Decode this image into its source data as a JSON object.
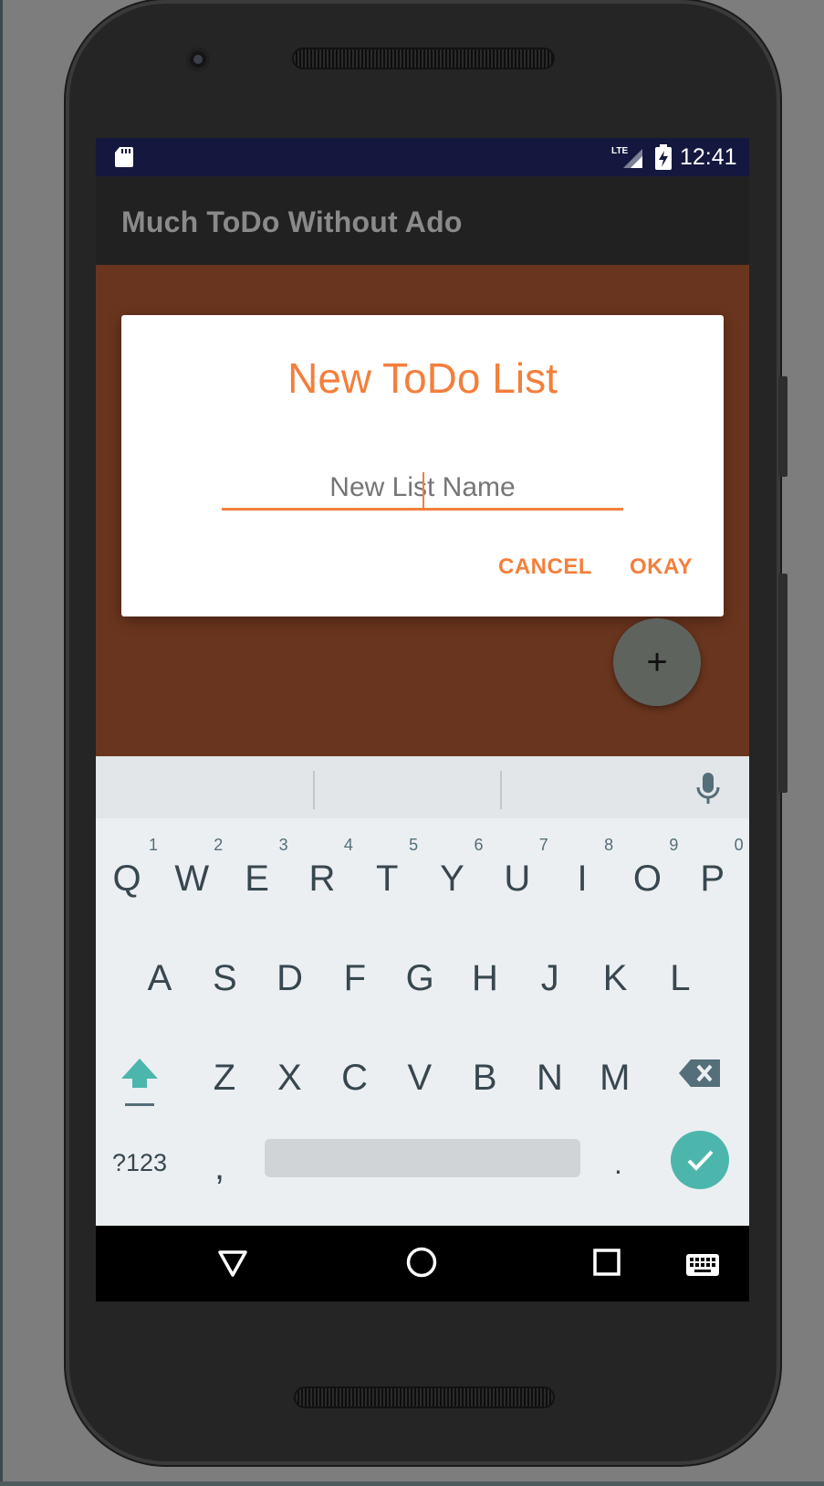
{
  "status_bar": {
    "time": "12:41",
    "icons": [
      "sd-card-icon",
      "lte-signal-icon",
      "battery-charging-icon"
    ]
  },
  "app_bar": {
    "title": "Much ToDo Without Ado"
  },
  "dialog": {
    "title": "New ToDo List",
    "input_placeholder": "New List Name",
    "input_value": "",
    "cancel_label": "CANCEL",
    "okay_label": "OKAY"
  },
  "fab": {
    "icon": "plus-icon",
    "label": "+"
  },
  "keyboard": {
    "row1": [
      {
        "key": "Q",
        "hint": "1"
      },
      {
        "key": "W",
        "hint": "2"
      },
      {
        "key": "E",
        "hint": "3"
      },
      {
        "key": "R",
        "hint": "4"
      },
      {
        "key": "T",
        "hint": "5"
      },
      {
        "key": "Y",
        "hint": "6"
      },
      {
        "key": "U",
        "hint": "7"
      },
      {
        "key": "I",
        "hint": "8"
      },
      {
        "key": "O",
        "hint": "9"
      },
      {
        "key": "P",
        "hint": "0"
      }
    ],
    "row2": [
      "A",
      "S",
      "D",
      "F",
      "G",
      "H",
      "J",
      "K",
      "L"
    ],
    "row3": [
      "Z",
      "X",
      "C",
      "V",
      "B",
      "N",
      "M"
    ],
    "symbols_label": "?123",
    "comma_label": ",",
    "period_label": ".",
    "icons": [
      "shift-icon",
      "backspace-icon",
      "mic-icon",
      "done-check-icon"
    ]
  },
  "nav_bar": {
    "icons": [
      "back-icon",
      "home-icon",
      "recents-icon",
      "keyboard-switch-icon"
    ]
  },
  "colors": {
    "accent": "#f37f3c",
    "content_background": "#6a351e",
    "status_bar": "#14183f",
    "app_bar": "#212121",
    "keyboard_accent": "#4db6ac"
  }
}
